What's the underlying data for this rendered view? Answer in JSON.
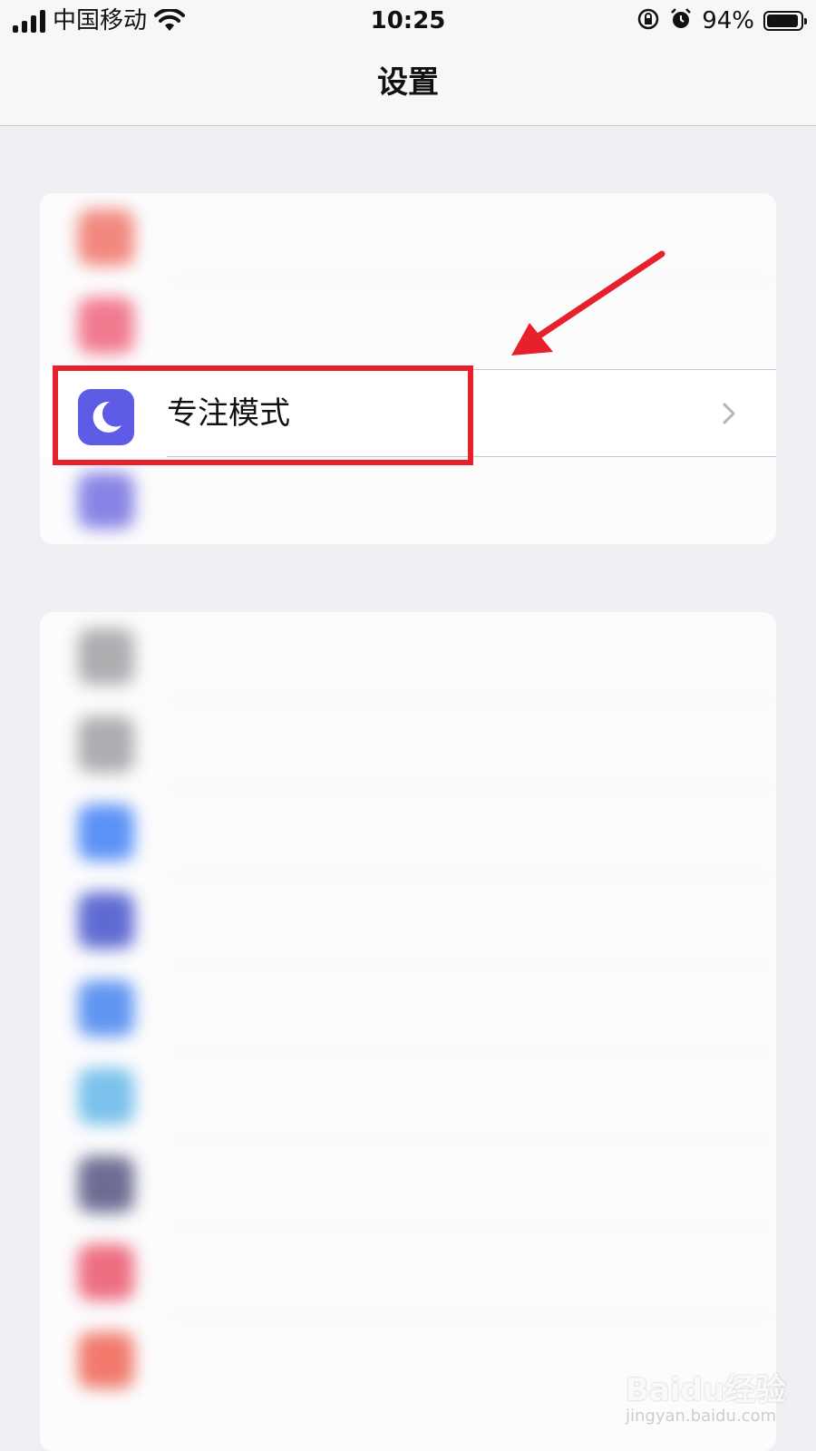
{
  "status_bar": {
    "carrier": "中国移动",
    "time": "10:25",
    "battery_percent": "94%",
    "battery_level": 0.94,
    "icons": [
      "cellular-signal-icon",
      "wifi-icon",
      "orientation-lock-icon",
      "alarm-icon",
      "battery-icon"
    ]
  },
  "nav": {
    "title": "设置"
  },
  "group1": {
    "rows_blurred": [
      {
        "icon_color": "#f06b5e",
        "label": ""
      },
      {
        "icon_color": "#ef5a73",
        "label": ""
      }
    ],
    "focus_row": {
      "label": "专注模式",
      "icon": "moon-icon",
      "icon_color": "#5e5ce6"
    },
    "rows_blurred_after": [
      {
        "icon_color": "#6a66e0",
        "label": ""
      }
    ]
  },
  "group2": {
    "rows_blurred": [
      {
        "icon_color": "#9a9a9e",
        "label": ""
      },
      {
        "icon_color": "#9a9a9e",
        "label": ""
      },
      {
        "icon_color": "#3478f6",
        "label": ""
      },
      {
        "icon_color": "#3847c9",
        "label": ""
      },
      {
        "icon_color": "#3a7cf0",
        "label": ""
      },
      {
        "icon_color": "#5ab3e8",
        "label": ""
      },
      {
        "icon_color": "#4a4a7a",
        "label": ""
      },
      {
        "icon_color": "#ea4b63",
        "label": ""
      },
      {
        "icon_color": "#ef5a4a",
        "label": ""
      }
    ]
  },
  "annotation": {
    "highlight_color": "#e8202c"
  },
  "watermark": {
    "main": "Baidu经验",
    "sub": "jingyan.baidu.com"
  }
}
